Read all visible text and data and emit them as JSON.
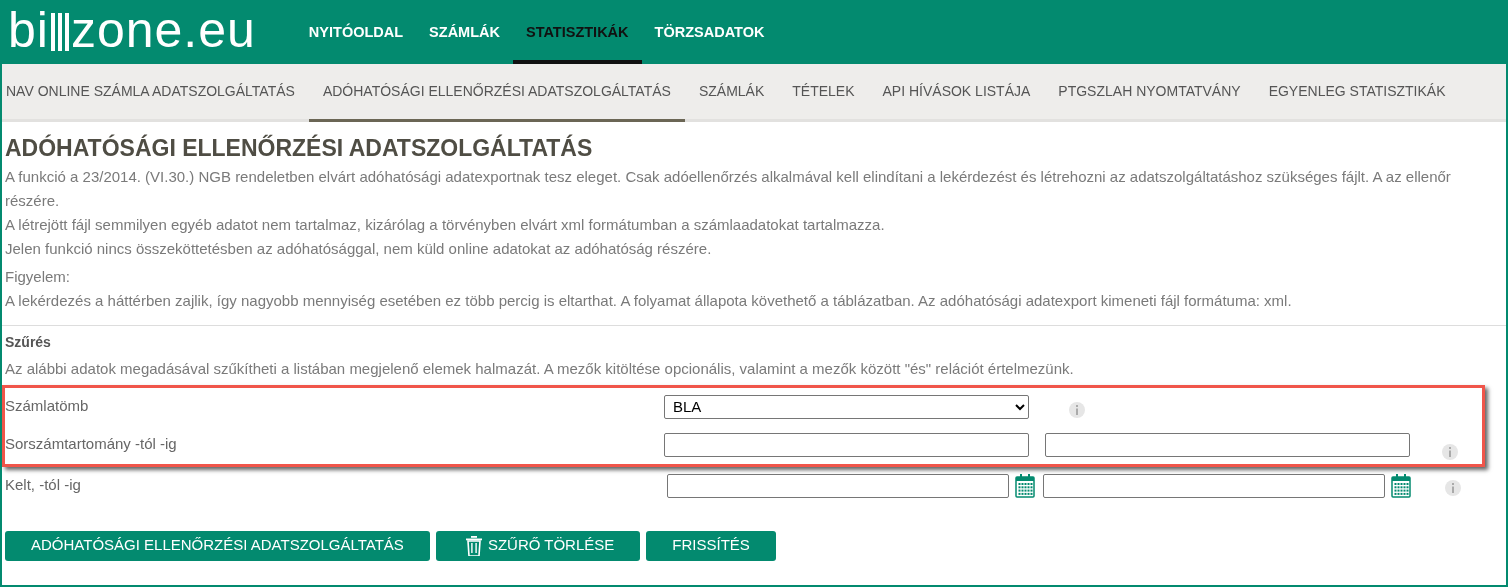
{
  "logo": {
    "prefix": "bi",
    "suffix": "zone.eu"
  },
  "main_nav": [
    {
      "label": "NYITÓOLDAL",
      "selected": false
    },
    {
      "label": "SZÁMLÁK",
      "selected": false
    },
    {
      "label": "STATISZTIKÁK",
      "selected": true
    },
    {
      "label": "TÖRZSADATOK",
      "selected": false
    }
  ],
  "sub_nav": [
    {
      "label": "NAV ONLINE SZÁMLA ADATSZOLGÁLTATÁS",
      "selected": false
    },
    {
      "label": "ADÓHATÓSÁGI ELLENŐRZÉSI ADATSZOLGÁLTATÁS",
      "selected": true
    },
    {
      "label": "SZÁMLÁK",
      "selected": false
    },
    {
      "label": "TÉTELEK",
      "selected": false
    },
    {
      "label": "API HÍVÁSOK LISTÁJA",
      "selected": false
    },
    {
      "label": "PTGSZLAH NYOMTATVÁNY",
      "selected": false
    },
    {
      "label": "EGYENLEG STATISZTIKÁK",
      "selected": false
    }
  ],
  "page_title": "ADÓHATÓSÁGI ELLENŐRZÉSI ADATSZOLGÁLTATÁS",
  "paragraphs": [
    "A funkció a 23/2014. (VI.30.) NGB rendeletben elvárt adóhatósági adatexportnak tesz eleget. Csak adóellenőrzés alkalmával kell elindítani a lekérdezést és létrehozni az adatszolgáltatáshoz szükséges fájlt. A az ellenőr részére.",
    "A létrejött fájl semmilyen egyéb adatot nem tartalmaz, kizárólag a törvényben elvárt xml formátumban a számlaadatokat tartalmazza.",
    "Jelen funkció nincs összeköttetésben az adóhatósággal, nem küld online adatokat az adóhatóság részére."
  ],
  "notice": {
    "label": "Figyelem:",
    "text": "A lekérdezés a háttérben zajlik, így nagyobb mennyiség esetében ez több percig is eltarthat. A folyamat állapota követhető a táblázatban. Az adóhatósági adatexport kimeneti fájl formátuma: xml."
  },
  "filter": {
    "title": "Szűrés",
    "description": "Az alábbi adatok megadásával szűkítheti a listában megjelenő elemek halmazát. A mezők kitöltése opcionális, valamint a mezők között \"és\" relációt értelmezünk.",
    "rows": [
      {
        "kind": "select",
        "label": "Számlatömb",
        "value": "BLA",
        "highlighted": true
      },
      {
        "kind": "range",
        "label": "Sorszámtartomány -tól -ig",
        "highlighted": true
      },
      {
        "kind": "date_range",
        "label": "Kelt, -tól -ig",
        "highlighted": false
      }
    ]
  },
  "buttons": [
    {
      "label": "ADÓHATÓSÁGI ELLENŐRZÉSI ADATSZOLGÁLTATÁS",
      "kind": "plain"
    },
    {
      "label": "SZŰRŐ TÖRLÉSE",
      "kind": "delete"
    },
    {
      "label": "FRISSÍTÉS",
      "kind": "plain"
    }
  ]
}
